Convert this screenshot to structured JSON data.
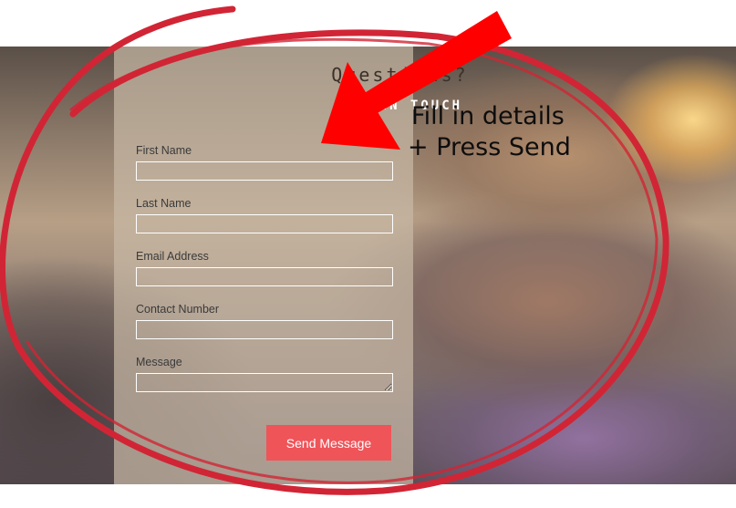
{
  "form": {
    "title": "Questions?",
    "subtitle": "GET IN TOUCH",
    "fields": [
      {
        "label": "First Name",
        "value": "",
        "type": "input"
      },
      {
        "label": "Last Name",
        "value": "",
        "type": "input"
      },
      {
        "label": "Email Address",
        "value": "",
        "type": "input"
      },
      {
        "label": "Contact Number",
        "value": "",
        "type": "input"
      },
      {
        "label": "Message",
        "value": "",
        "type": "textarea"
      }
    ],
    "submit_label": "Send Message",
    "submit_color": "#ef5459"
  },
  "annotation": {
    "line1": "Fill in details",
    "line2": "+ Press Send",
    "arrow_color": "#ff0000",
    "circle_color": "#d12535"
  }
}
